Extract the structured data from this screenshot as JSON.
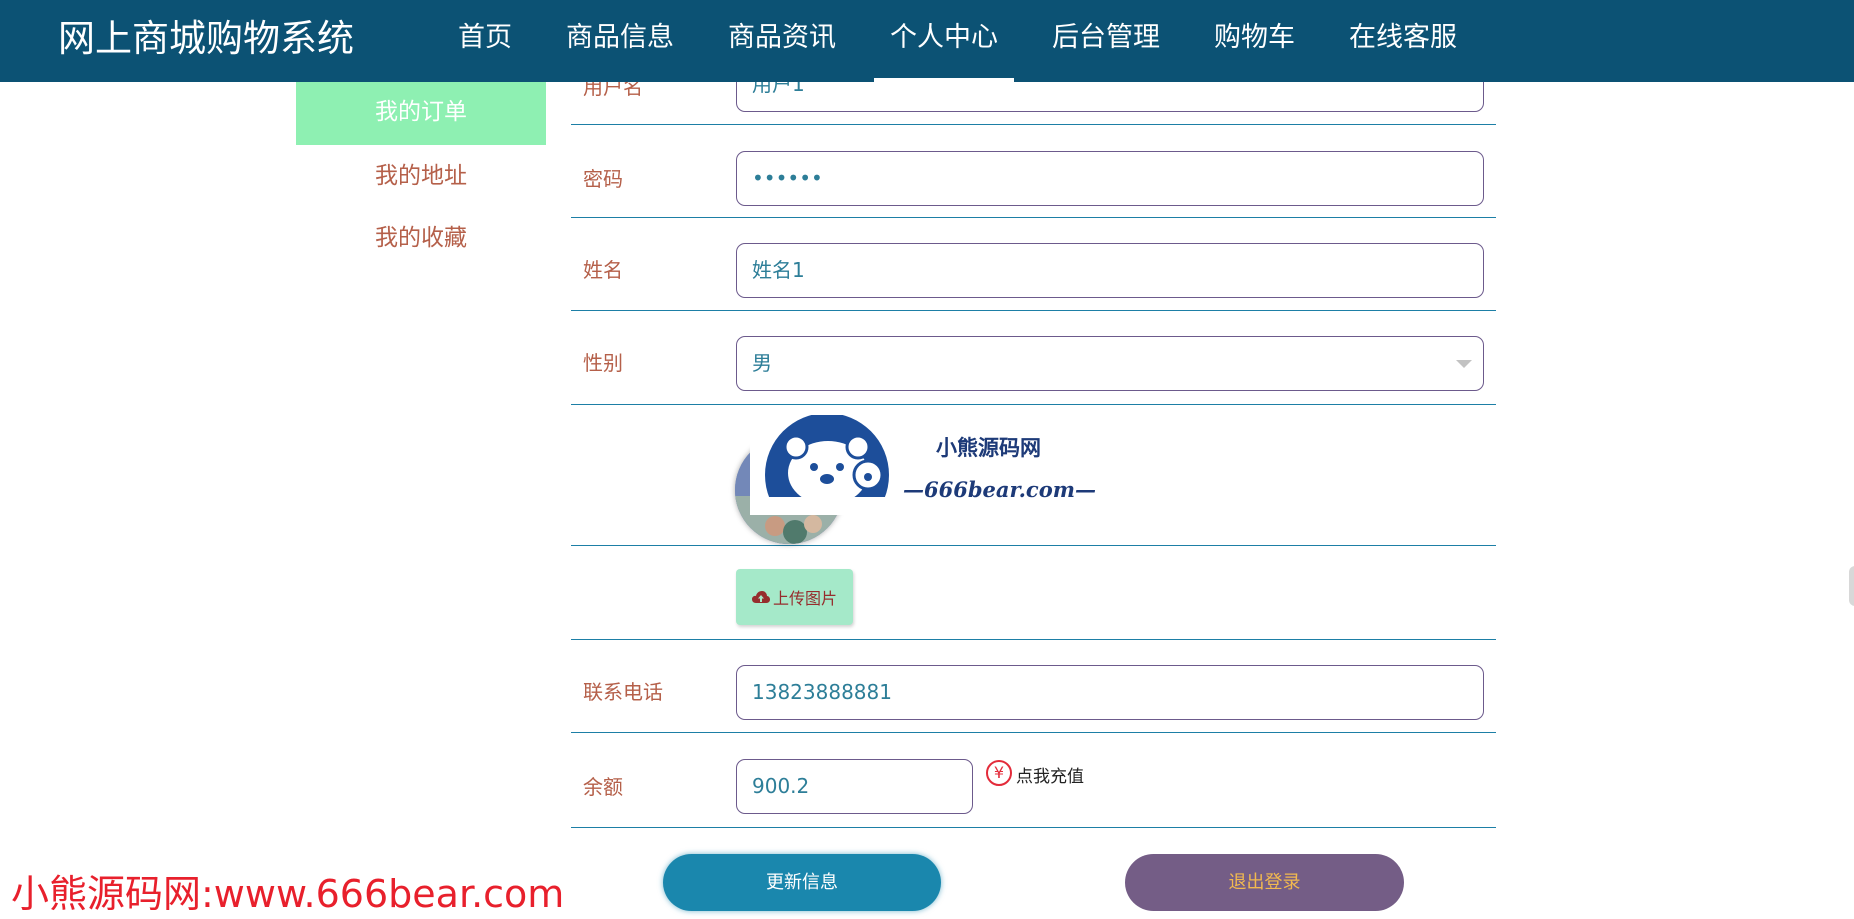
{
  "header": {
    "brand": "网上商城购物系统",
    "nav": [
      {
        "label": "首页",
        "active": false
      },
      {
        "label": "商品信息",
        "active": false
      },
      {
        "label": "商品资讯",
        "active": false
      },
      {
        "label": "个人中心",
        "active": true
      },
      {
        "label": "后台管理",
        "active": false
      },
      {
        "label": "购物车",
        "active": false
      },
      {
        "label": "在线客服",
        "active": false
      }
    ]
  },
  "sidebar": {
    "items": [
      {
        "label": "我的订单",
        "active": true
      },
      {
        "label": "我的地址",
        "active": false
      },
      {
        "label": "我的收藏",
        "active": false
      }
    ]
  },
  "form": {
    "username": {
      "label": "用户名",
      "value": "用户1"
    },
    "password": {
      "label": "密码",
      "value": "••••••"
    },
    "name": {
      "label": "姓名",
      "value": "姓名1"
    },
    "gender": {
      "label": "性别",
      "value": "男"
    },
    "avatar": {
      "watermark_title": "小熊源码网",
      "watermark_url": "—666bear.com—"
    },
    "upload": {
      "label": "上传图片",
      "icon": "cloud-upload-icon"
    },
    "phone": {
      "label": "联系电话",
      "value": "13823888881"
    },
    "balance": {
      "label": "余额",
      "value": "900.2",
      "recharge_label": "点我充值",
      "recharge_icon": "¥"
    }
  },
  "actions": {
    "update": "更新信息",
    "logout": "退出登录"
  },
  "watermark": {
    "footer": "小熊源码网:www.666bear.com"
  },
  "colors": {
    "header_bg": "#0c5274",
    "sidebar_active": "#8ef0b2",
    "label": "#b5604a",
    "input_text": "#2d7e98",
    "update_btn": "#1a87ad",
    "logout_btn": "#745d86",
    "logout_text": "#f2b94f",
    "watermark_red": "#e8202c"
  }
}
